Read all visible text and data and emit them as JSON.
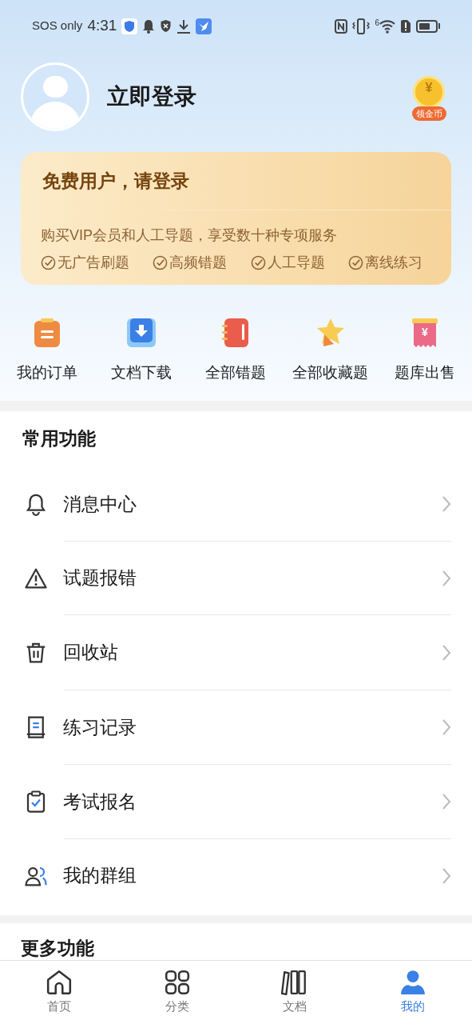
{
  "status_bar": {
    "carrier": "SOS only",
    "time": "4:31",
    "wifi_badge": "6"
  },
  "profile": {
    "login": "立即登录",
    "coin_label": "领金币",
    "coin_symbol": "¥"
  },
  "vip_card": {
    "title": "免费用户，请登录",
    "subtitle": "购买VIP会员和人工导题，享受数十种专项服务",
    "perks": [
      "无广告刷题",
      "高频错题",
      "人工导题",
      "离线练习"
    ]
  },
  "shortcuts": [
    {
      "label": "我的订单"
    },
    {
      "label": "文档下载"
    },
    {
      "label": "全部错题"
    },
    {
      "label": "全部收藏题"
    },
    {
      "label": "题库出售",
      "symbol": "¥"
    }
  ],
  "common": {
    "title": "常用功能",
    "items": [
      {
        "label": "消息中心"
      },
      {
        "label": "试题报错"
      },
      {
        "label": "回收站"
      },
      {
        "label": "练习记录"
      },
      {
        "label": "考试报名"
      },
      {
        "label": "我的群组"
      }
    ]
  },
  "more": {
    "title": "更多功能"
  },
  "tabs": [
    {
      "label": "首页",
      "selected": false
    },
    {
      "label": "分类",
      "selected": false
    },
    {
      "label": "文档",
      "selected": false
    },
    {
      "label": "我的",
      "selected": true
    }
  ]
}
